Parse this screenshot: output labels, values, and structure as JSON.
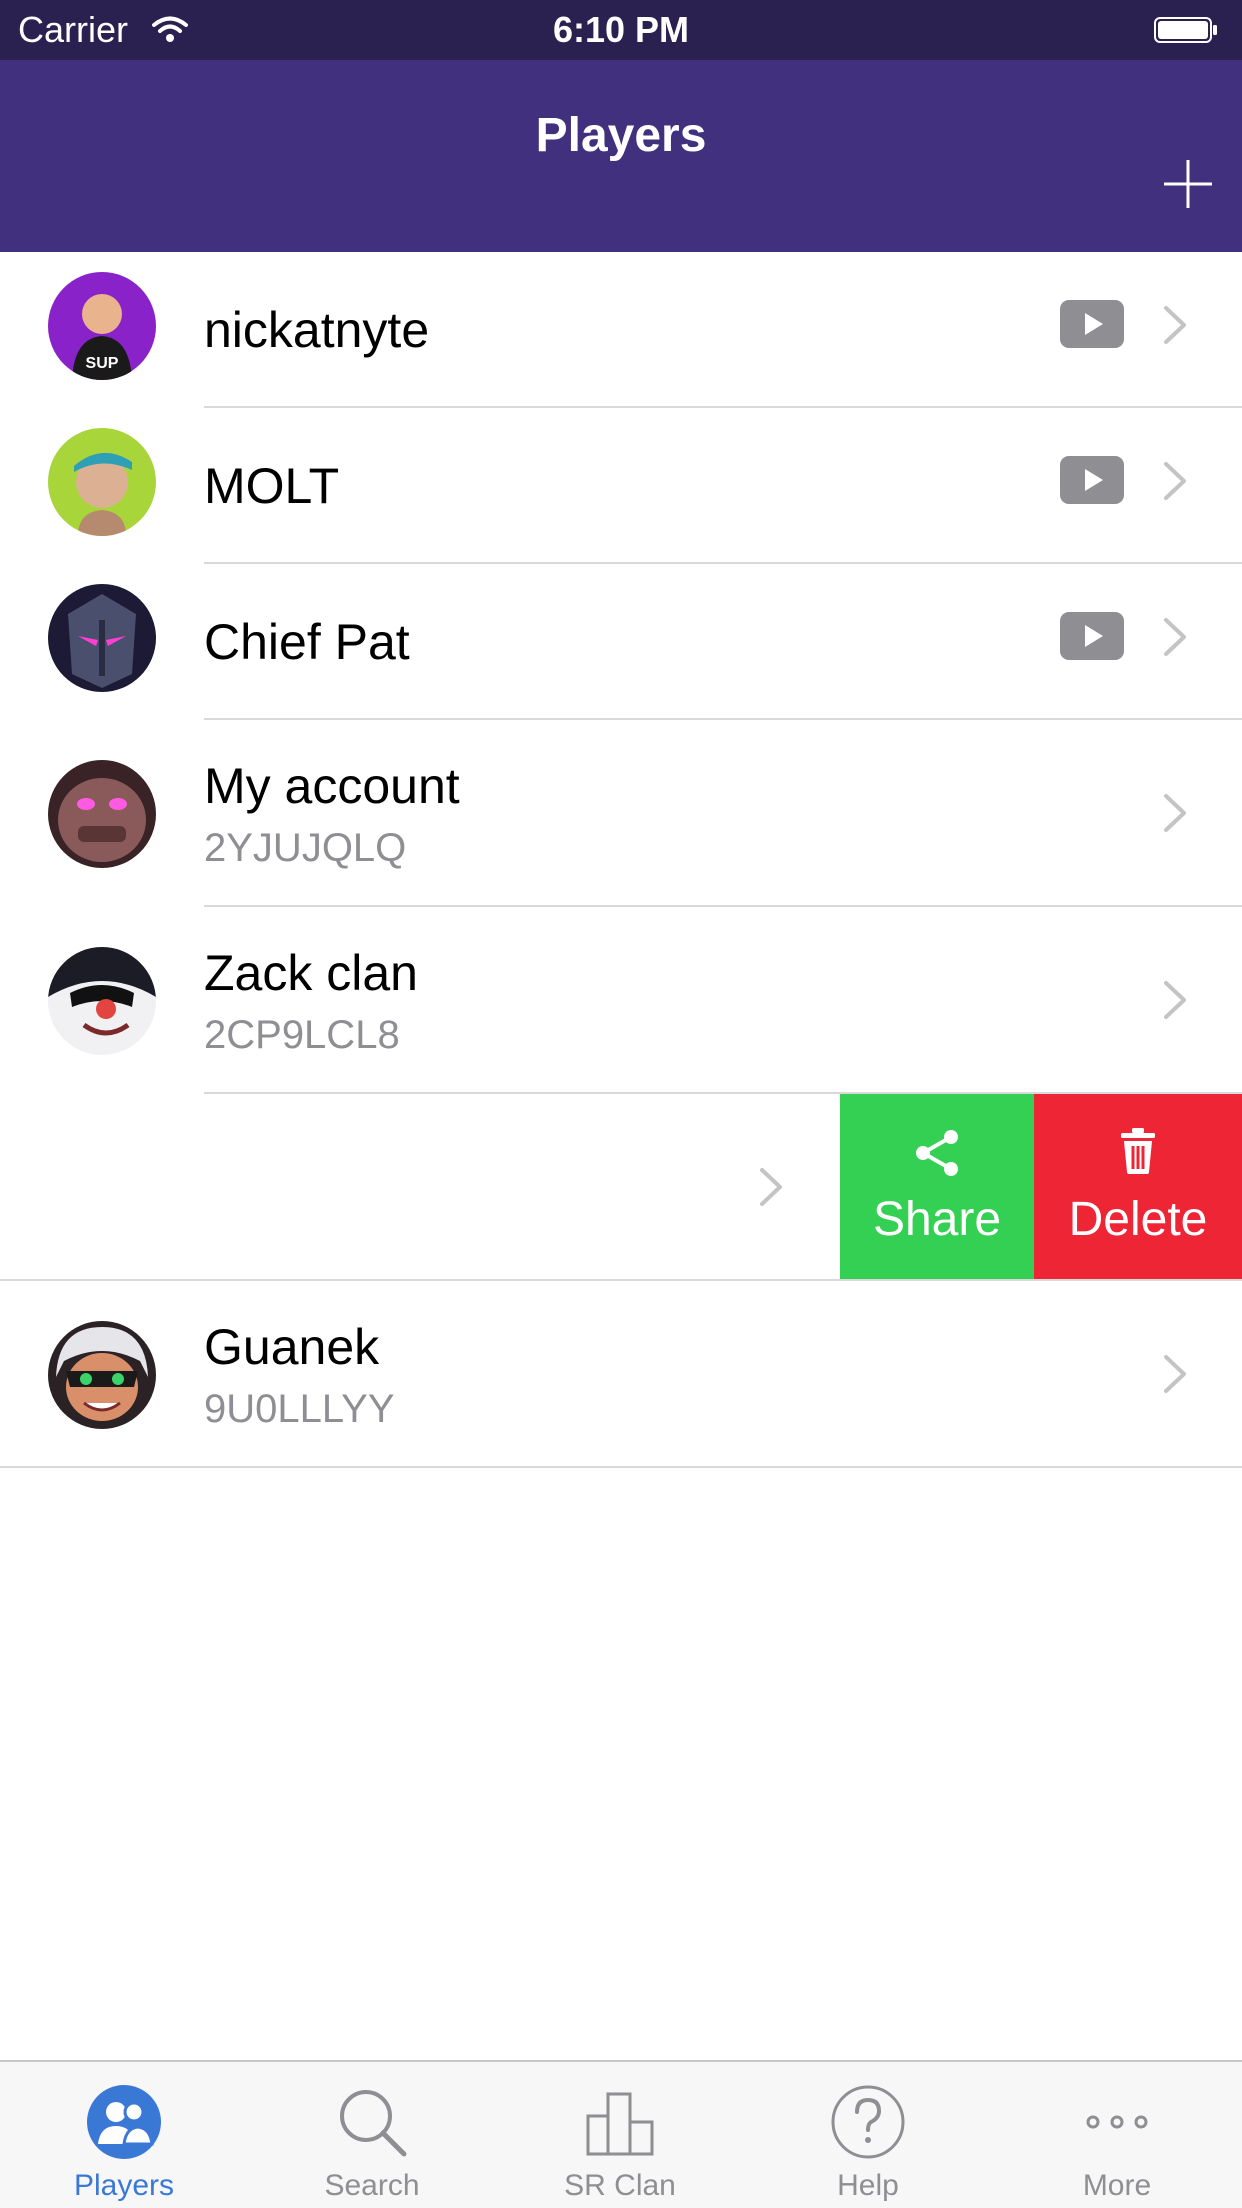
{
  "status_bar": {
    "carrier": "Carrier",
    "time": "6:10 PM"
  },
  "nav": {
    "title": "Players",
    "add_icon": "plus-icon"
  },
  "players": [
    {
      "name": "nickatnyte",
      "tag": "",
      "youtube": true
    },
    {
      "name": "MOLT",
      "tag": "",
      "youtube": true
    },
    {
      "name": "Chief Pat",
      "tag": "",
      "youtube": true
    },
    {
      "name": "My account",
      "tag": "2YJUJQLQ",
      "youtube": false
    },
    {
      "name": "Zack clan",
      "tag": "2CP9LCL8",
      "youtube": false
    },
    {
      "name": "",
      "tag": "",
      "youtube": false
    },
    {
      "name": "Guanek",
      "tag": "9U0LLLYY",
      "youtube": false
    }
  ],
  "swipe_actions": {
    "share_label": "Share",
    "delete_label": "Delete"
  },
  "tabs": [
    {
      "label": "Players",
      "icon": "players-icon",
      "active": true
    },
    {
      "label": "Search",
      "icon": "search-icon",
      "active": false
    },
    {
      "label": "SR Clan",
      "icon": "clan-chart-icon",
      "active": false
    },
    {
      "label": "Help",
      "icon": "help-icon",
      "active": false
    },
    {
      "label": "More",
      "icon": "more-icon",
      "active": false
    }
  ],
  "colors": {
    "nav_bg": "#40307e",
    "status_bg": "#2b2150",
    "share_bg": "#33d053",
    "delete_bg": "#ee2534",
    "tab_active": "#3a78d6"
  }
}
